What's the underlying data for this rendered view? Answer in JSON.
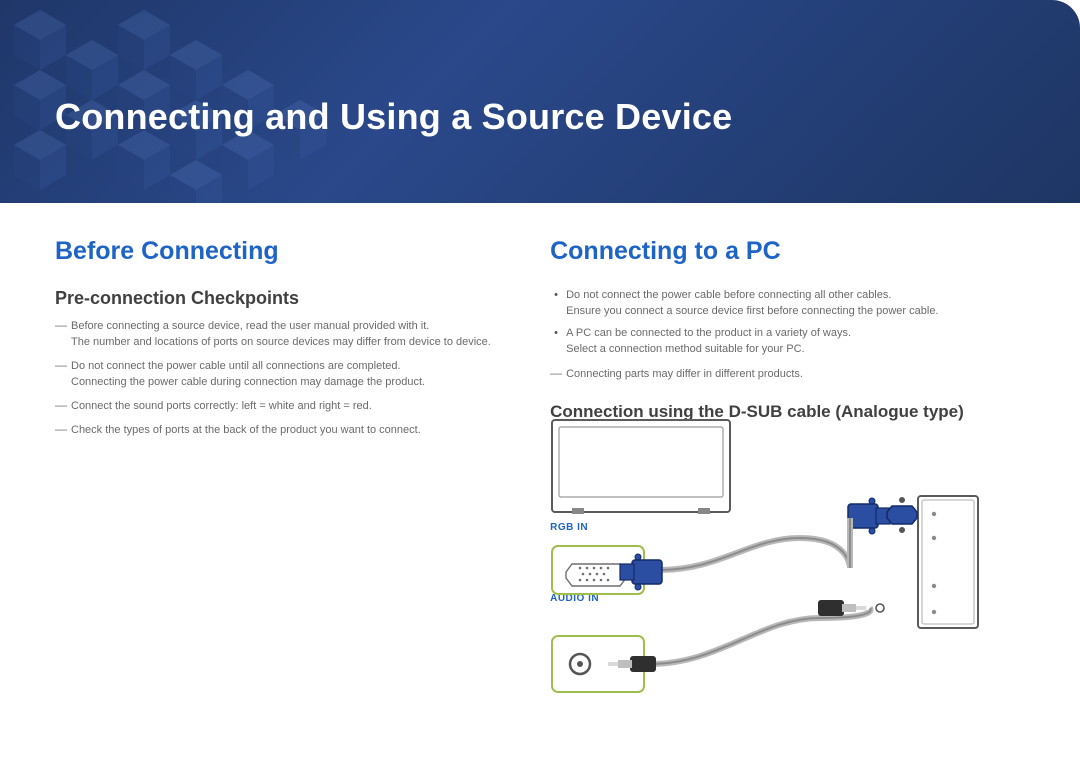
{
  "banner": {
    "title": "Connecting and Using a Source Device"
  },
  "left": {
    "heading": "Before Connecting",
    "sub": "Pre-connection Checkpoints",
    "items": [
      {
        "line": "Before connecting a source device, read the user manual provided with it.",
        "sub": "The number and locations of ports on source devices may differ from device to device."
      },
      {
        "line": "Do not connect the power cable until all connections are completed.",
        "sub": "Connecting the power cable during connection may damage the product."
      },
      {
        "line": "Connect the sound ports correctly: left = white and right = red."
      },
      {
        "line": "Check the types of ports at the back of the product you want to connect."
      }
    ]
  },
  "right": {
    "heading": "Connecting to a PC",
    "bullets": [
      {
        "line": "Do not connect the power cable before connecting all other cables.",
        "sub": "Ensure you connect a source device first before connecting the power cable."
      },
      {
        "line": "A PC can be connected to the product in a variety of ways.",
        "sub": "Select a connection method suitable for your PC."
      }
    ],
    "note": "Connecting parts may differ in different products.",
    "sub": "Connection using the D-SUB cable (Analogue type)",
    "labels": {
      "rgb": "RGB IN",
      "audio": "AUDIO IN"
    }
  }
}
